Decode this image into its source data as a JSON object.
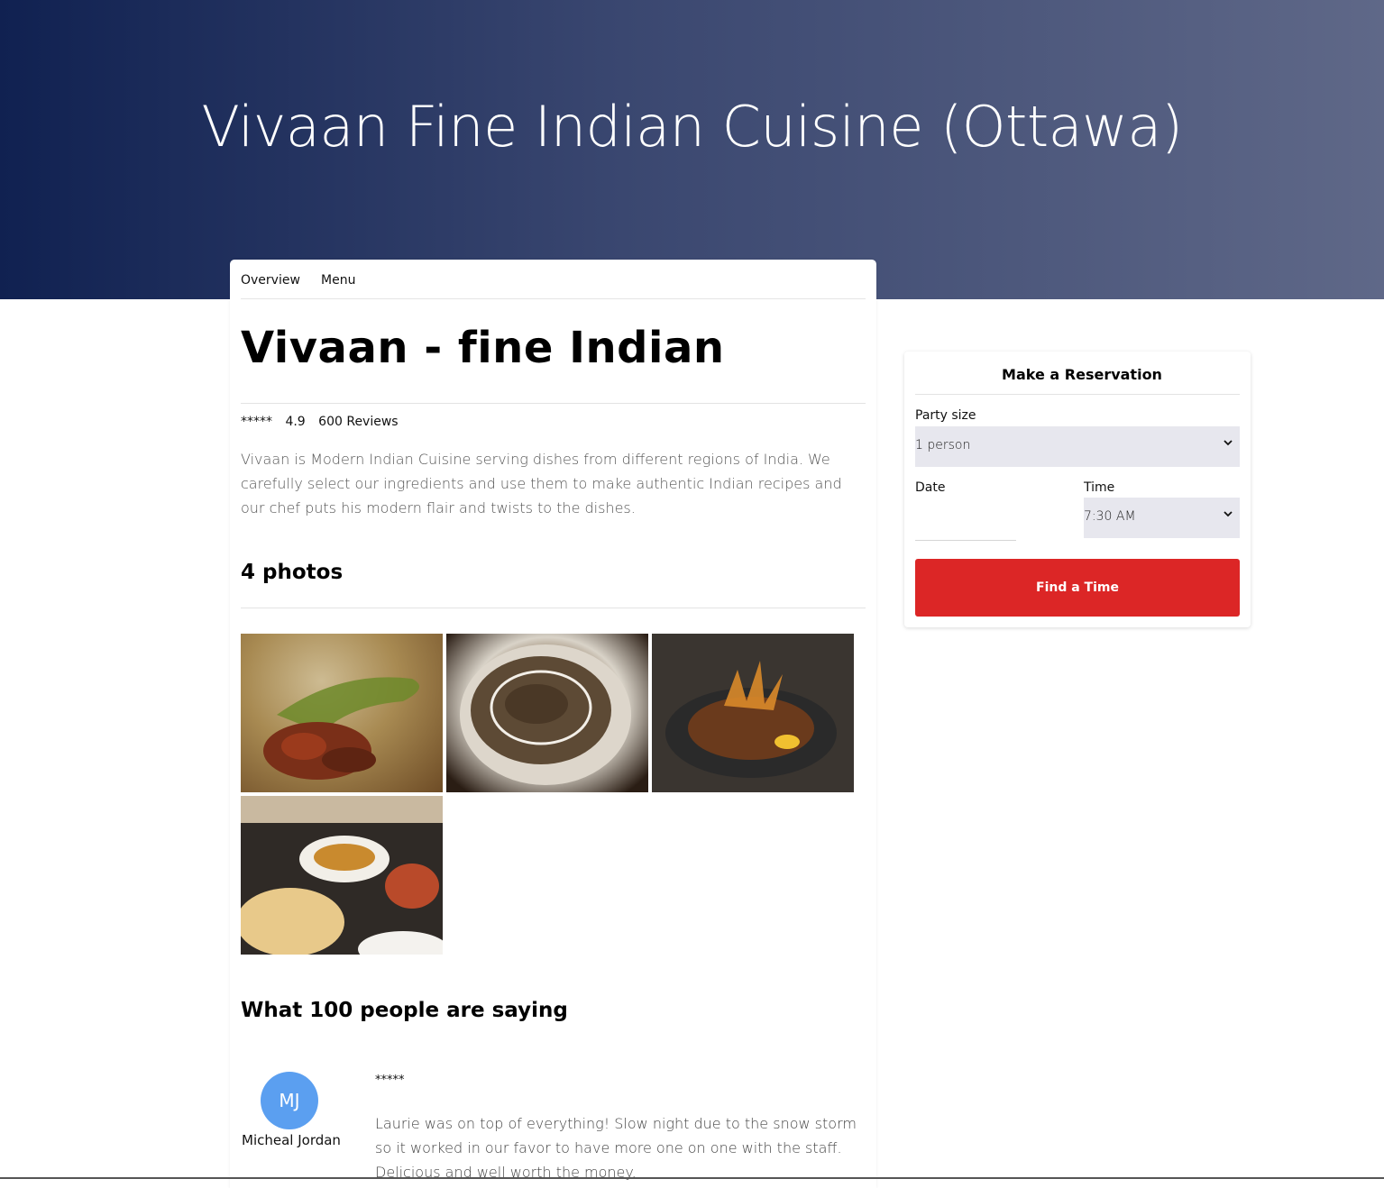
{
  "hero": {
    "title": "Vivaan Fine Indian Cuisine (Ottawa)"
  },
  "tabs": [
    {
      "label": "Overview"
    },
    {
      "label": "Menu"
    }
  ],
  "restaurant": {
    "name": "Vivaan - fine Indian",
    "stars": "*****",
    "rating": "4.9",
    "reviews": "600 Reviews",
    "description": "Vivaan is Modern Indian Cuisine serving dishes from different regions of India. We carefully select our ingredients and use them to make authentic Indian recipes and our chef puts his modern flair and twists to the dishes."
  },
  "photos": {
    "title": "4 photos"
  },
  "reviews_section": {
    "title": "What 100 people are saying",
    "items": [
      {
        "initials": "MJ",
        "name": "Micheal Jordan",
        "stars": "*****",
        "text": "Laurie was on top of everything! Slow night due to the snow storm so it worked in our favor to have more one on one with the staff. Delicious and well worth the money."
      }
    ]
  },
  "reservation": {
    "title": "Make a Reservation",
    "party_label": "Party size",
    "party_value": "1 person",
    "date_label": "Date",
    "time_label": "Time",
    "time_value": "7:30 AM",
    "button": "Find a Time"
  },
  "colors": {
    "accent": "#dc2626",
    "avatar": "#5b9ff0",
    "hero_start": "#102151",
    "hero_end": "#5f6888"
  }
}
